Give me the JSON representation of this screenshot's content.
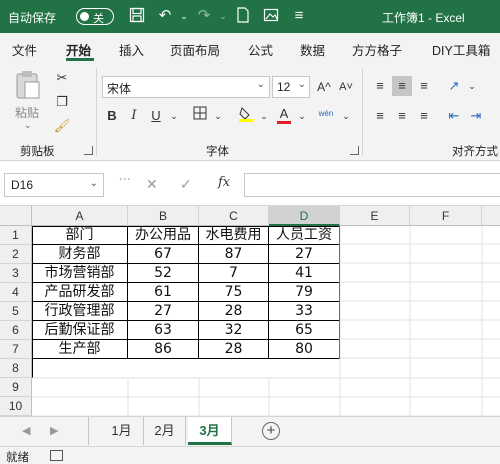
{
  "titlebar": {
    "autosave_label": "自动保存",
    "toggle_label": "关",
    "doc_title": "工作簿1 - Excel"
  },
  "ribbon_tabs": [
    "文件",
    "开始",
    "插入",
    "页面布局",
    "公式",
    "数据",
    "方方格子",
    "DIY工具箱"
  ],
  "active_tab": "开始",
  "ribbon": {
    "paste_label": "粘贴",
    "clipboard_group": "剪贴板",
    "font_name": "宋体",
    "font_size": "12",
    "font_group": "字体",
    "bold": "B",
    "italic": "I",
    "underline": "U",
    "grow_font": "A^",
    "shrink_font": "A˅",
    "wen_label": "wén",
    "align_group": "对齐方式"
  },
  "formula_bar": {
    "name_box": "D16",
    "fx_label": "fx",
    "formula_value": ""
  },
  "grid": {
    "columns": [
      "A",
      "B",
      "C",
      "D",
      "E",
      "F"
    ],
    "selected_column": "D",
    "rows": [
      "1",
      "2",
      "3",
      "4",
      "5",
      "6",
      "7",
      "8",
      "9",
      "10"
    ],
    "data": [
      [
        "部门",
        "办公用品",
        "水电费用",
        "人员工资"
      ],
      [
        "财务部",
        "67",
        "87",
        "27"
      ],
      [
        "市场营销部",
        "52",
        "7",
        "41"
      ],
      [
        "产品研发部",
        "61",
        "75",
        "79"
      ],
      [
        "行政管理部",
        "27",
        "28",
        "33"
      ],
      [
        "后勤保证部",
        "63",
        "32",
        "65"
      ],
      [
        "生产部",
        "86",
        "28",
        "80"
      ]
    ]
  },
  "sheets": {
    "tabs": [
      "1月",
      "2月",
      "3月"
    ],
    "active": "3月",
    "add_label": "+"
  },
  "status": {
    "ready": "就绪"
  },
  "colors": {
    "accent": "#217346",
    "ribbon_bg": "#f3f3f3",
    "header_bg": "#efefef"
  }
}
